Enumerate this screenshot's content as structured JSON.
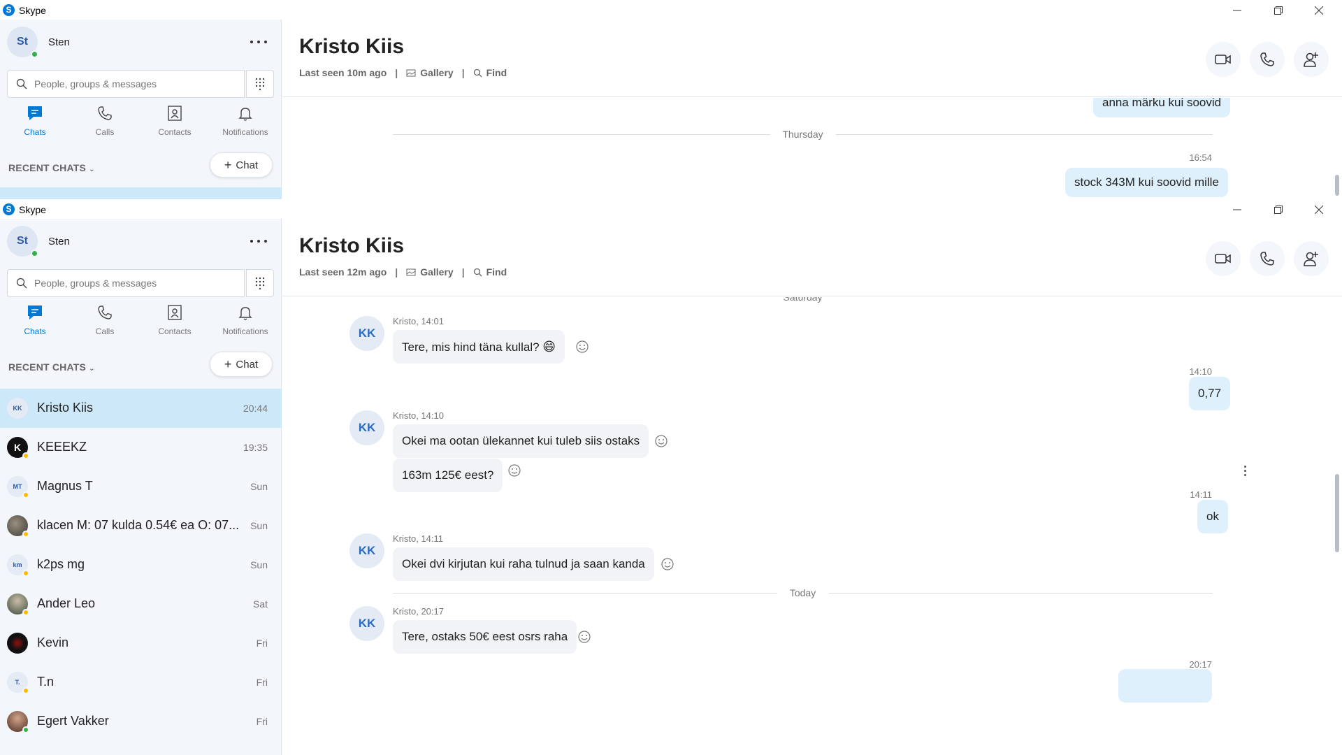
{
  "app": {
    "title": "Skype"
  },
  "profile": {
    "initials": "St",
    "name": "Sten"
  },
  "search": {
    "placeholder": "People, groups & messages"
  },
  "nav": {
    "chats": "Chats",
    "calls": "Calls",
    "contacts": "Contacts",
    "notifications": "Notifications"
  },
  "recent": {
    "header": "RECENT CHATS",
    "new_chat": "Chat"
  },
  "chats": [
    {
      "name": "Kristo Kiis",
      "time": "20:44",
      "initials": "KK"
    },
    {
      "name": "KEEEKZ",
      "time": "19:35",
      "initials": "K"
    },
    {
      "name": "Magnus T",
      "time": "Sun",
      "initials": "MT"
    },
    {
      "name": "klacen M: 07 kulda 0.54€ ea  O: 07...",
      "time": "Sun",
      "initials": ""
    },
    {
      "name": "k2ps mg",
      "time": "Sun",
      "initials": "km"
    },
    {
      "name": "Ander Leo",
      "time": "Sat",
      "initials": ""
    },
    {
      "name": "Kevin",
      "time": "Fri",
      "initials": ""
    },
    {
      "name": "T.n",
      "time": "Fri",
      "initials": "T."
    },
    {
      "name": "Egert Vakker",
      "time": "Fri",
      "initials": ""
    }
  ],
  "conversation1": {
    "title": "Kristo Kiis",
    "last_seen": "Last seen 10m ago",
    "gallery": "Gallery",
    "find": "Find",
    "msg_top": "anna märku kui soovid",
    "day": "Thursday",
    "time": "16:54",
    "msg_partial": "stock 343M kui soovid mille"
  },
  "conversation2": {
    "title": "Kristo Kiis",
    "last_seen": "Last seen 12m ago",
    "gallery": "Gallery",
    "find": "Find",
    "day_top": "Saturday",
    "day_today": "Today",
    "avatar": "KK",
    "messages": {
      "m1_sender": "Kristo, 14:01",
      "m1_text": "Tere, mis hind täna kullal?",
      "m1_emoji": "😄",
      "out1_time": "14:10",
      "out1_text": "0,77",
      "m2_sender": "Kristo, 14:10",
      "m2_text": "Okei ma ootan ülekannet kui tuleb siis ostaks",
      "m3_text": "163m 125€ eest?",
      "out2_time": "14:11",
      "out2_text": "ok",
      "m4_sender": "Kristo, 14:11",
      "m4_text": "Okei dvi kirjutan kui raha tulnud ja saan kanda",
      "m5_sender": "Kristo, 20:17",
      "m5_text": "Tere, ostaks 50€ eest osrs raha",
      "out3_time": "20:17"
    }
  },
  "colors": {
    "accent": "#0078d4",
    "selected_row": "#cde8f8",
    "outgoing_bubble": "#ddf0fc",
    "incoming_bubble": "#f1f3f6",
    "sidebar_bg": "#f3f6fb"
  }
}
